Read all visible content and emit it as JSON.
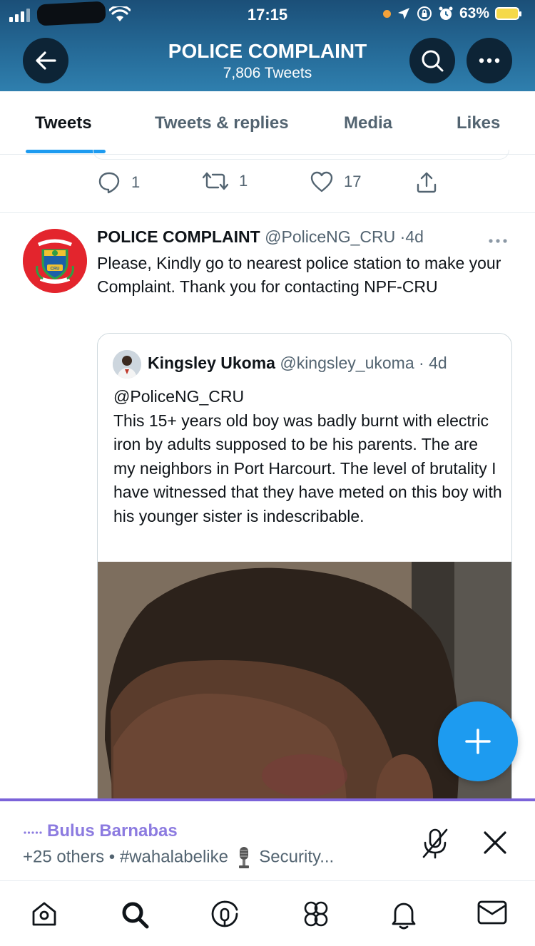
{
  "status": {
    "time": "17:15",
    "battery": "63%"
  },
  "header": {
    "title": "POLICE COMPLAINT",
    "subtitle": "7,806 Tweets"
  },
  "tabs": [
    {
      "label": "Tweets"
    },
    {
      "label": "Tweets & replies"
    },
    {
      "label": "Media"
    },
    {
      "label": "Likes"
    }
  ],
  "prev_tweet": {
    "replies": "1",
    "retweets": "1",
    "likes": "17"
  },
  "tweet": {
    "name": "POLICE COMPLAINT",
    "handle": "@PoliceNG_CRU",
    "time": "4d",
    "text": "Please, Kindly go to nearest police station to make your Complaint. Thank you for contacting NPF-CRU",
    "avatar_text": "CRU"
  },
  "quote": {
    "name": "Kingsley Ukoma",
    "handle": "@kingsley_ukoma",
    "time": "4d",
    "mention": "@PoliceNG_CRU",
    "text": "This 15+ years old boy was badly burnt with electric iron by adults supposed to be his parents. The are my neighbors in Port Harcourt. The level of brutality I have witnessed that they have meted on this boy with his younger sister is indescribable."
  },
  "spaces": {
    "host": "Bulus Barnabas",
    "others": "+25 others",
    "hashtag": "#wahalabelike",
    "title": "Security..."
  },
  "colors": {
    "accent": "#1d9bf0",
    "spaces": "#8c7be0",
    "header": "#256a97"
  }
}
